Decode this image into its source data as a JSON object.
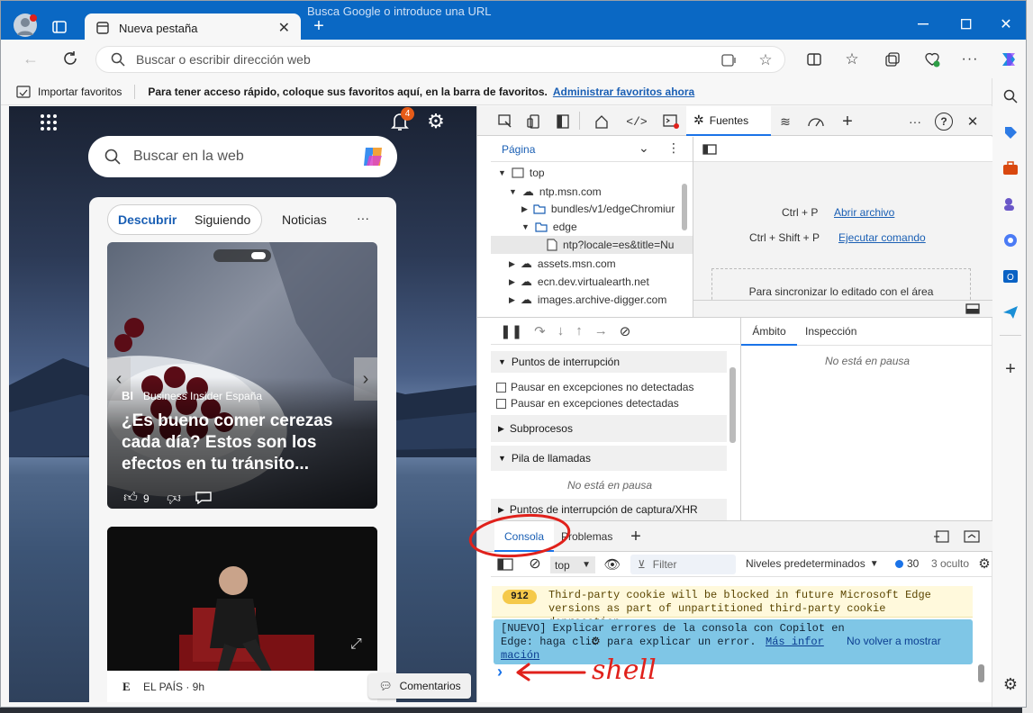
{
  "tab": {
    "title": "Nueva pestaña",
    "behind_text": "Busca Google o introduce una URL"
  },
  "address": {
    "placeholder": "Buscar o escribir dirección web"
  },
  "favbar": {
    "import_label": "Importar favoritos",
    "hint": "Para tener acceso rápido, coloque sus favoritos aquí, en la barra de favoritos.",
    "manage_link": "Administrar favoritos ahora"
  },
  "ntp": {
    "notification_count": "4",
    "search_placeholder": "Buscar en la web",
    "tabs": [
      "Descubrir",
      "Siguiendo",
      "Noticias"
    ],
    "more": "···",
    "card1": {
      "source_logo": "BI",
      "source": "Business Insider España",
      "headline": "¿Es bueno comer cerezas cada día? Estos son los efectos en tu tránsito...",
      "likes": "9"
    },
    "card2": {
      "source_logo": "E",
      "source": "EL PAÍS · 9h"
    },
    "comments_button": "Comentarios"
  },
  "devtools": {
    "sources_tab": "Fuentes",
    "page_label": "Página",
    "tree": [
      {
        "label": "top",
        "kind": "frame"
      },
      {
        "label": "ntp.msn.com",
        "kind": "cloud"
      },
      {
        "label": "bundles/v1/edgeChromiur",
        "kind": "folder"
      },
      {
        "label": "edge",
        "kind": "folder"
      },
      {
        "label": "ntp?locale=es&title=Nu",
        "kind": "file"
      },
      {
        "label": "assets.msn.com",
        "kind": "cloud"
      },
      {
        "label": "ecn.dev.virtualearth.net",
        "kind": "cloud"
      },
      {
        "label": "images.archive-digger.com",
        "kind": "cloud"
      }
    ],
    "shortcuts": [
      {
        "keys": "Ctrl + P",
        "action": "Abrir archivo"
      },
      {
        "keys": "Ctrl + Shift + P",
        "action": "Ejecutar comando"
      }
    ],
    "sync_text": "Para sincronizar lo editado con el área",
    "breakpoints": {
      "title": "Puntos de interrupción",
      "opt1": "Pausar en excepciones no detectadas",
      "opt2": "Pausar en excepciones detectadas",
      "threads": "Subprocesos",
      "callstack": "Pila de llamadas",
      "not_paused": "No está en pausa",
      "xhr": "Puntos de interrupción de captura/XHR"
    },
    "scope": {
      "tab1": "Ámbito",
      "tab2": "Inspección",
      "not_paused": "No está en pausa"
    },
    "console": {
      "tab1": "Consola",
      "tab2": "Problemas",
      "context": "top",
      "filter_placeholder": "Filter",
      "levels": "Niveles predeterminados",
      "issues_count": "30",
      "hidden": "3 oculto",
      "warning_count": "912",
      "warning_text": "Third-party cookie will be blocked in future Microsoft Edge versions as part of unpartitioned third-party cookie deprecation.",
      "info_text_1": "[NUEVO] Explicar errores de la consola con Copilot en",
      "info_text_2": "Edge: haga clic",
      "info_text_3": "para explicar un error.",
      "info_link": "Más infor",
      "info_link_2": "mación",
      "dismiss": "No volver a mostrar",
      "prompt": "›"
    }
  },
  "annotation": {
    "text": "shell",
    "color": "#e0211b"
  }
}
